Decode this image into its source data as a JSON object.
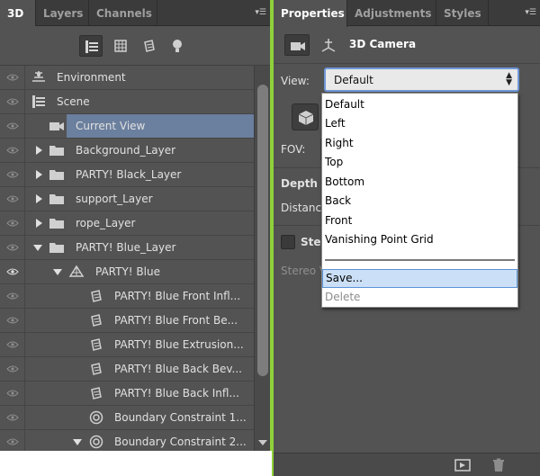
{
  "left_panel": {
    "tabs": [
      "3D",
      "Layers",
      "Channels"
    ],
    "active_tab": "3D",
    "filters": [
      "whole-scene-filter-icon",
      "meshes-filter-icon",
      "materials-filter-icon",
      "lights-filter-icon"
    ],
    "rows": [
      {
        "label": "Environment",
        "icon": "environment-icon"
      },
      {
        "label": "Scene",
        "icon": "scene-icon"
      },
      {
        "label": "Current View",
        "icon": "camera-icon",
        "selected": true
      },
      {
        "label": "Background_Layer",
        "icon": "folder-icon",
        "expanded": false
      },
      {
        "label": "PARTY! Black_Layer",
        "icon": "folder-icon",
        "expanded": false
      },
      {
        "label": "support_Layer",
        "icon": "folder-icon",
        "expanded": false
      },
      {
        "label": "rope_Layer",
        "icon": "folder-icon",
        "expanded": false
      },
      {
        "label": "PARTY! Blue_Layer",
        "icon": "folder-icon",
        "expanded": true
      },
      {
        "label": "PARTY! Blue",
        "icon": "mesh-icon",
        "expanded": true
      },
      {
        "label": "PARTY! Blue Front Infl...",
        "icon": "material-icon"
      },
      {
        "label": "PARTY! Blue Front Be...",
        "icon": "material-icon"
      },
      {
        "label": "PARTY! Blue Extrusion...",
        "icon": "material-icon"
      },
      {
        "label": "PARTY! Blue Back Bev...",
        "icon": "material-icon"
      },
      {
        "label": "PARTY! Blue Back Infl...",
        "icon": "material-icon"
      },
      {
        "label": "Boundary Constraint 1...",
        "icon": "constraint-icon"
      },
      {
        "label": "Boundary Constraint 2...",
        "icon": "constraint-icon",
        "expanded": true
      }
    ]
  },
  "right_panel": {
    "tabs": [
      "Properties",
      "Adjustments",
      "Styles"
    ],
    "active_tab": "Properties",
    "title": "3D Camera",
    "view_label": "View:",
    "view_value": "Default",
    "fov_label": "FOV:",
    "depth_label": "Depth C",
    "distance_label": "Distance",
    "stereo_label": "Stere",
    "stereo_view_label": "Stereo V"
  },
  "dropdown": {
    "items": [
      "Default",
      "Left",
      "Right",
      "Top",
      "Bottom",
      "Back",
      "Front",
      "Vanishing Point Grid"
    ],
    "actions": [
      {
        "label": "Save...",
        "hover": true
      },
      {
        "label": "Delete",
        "disabled": true
      }
    ]
  },
  "colors": {
    "panel_bg": "#535353",
    "tab_bg": "#3b3b3b",
    "selection": "#6b7f9e",
    "panel_border_accent": "#8fd13a",
    "dropdown_hover": "#cbe0f7"
  }
}
